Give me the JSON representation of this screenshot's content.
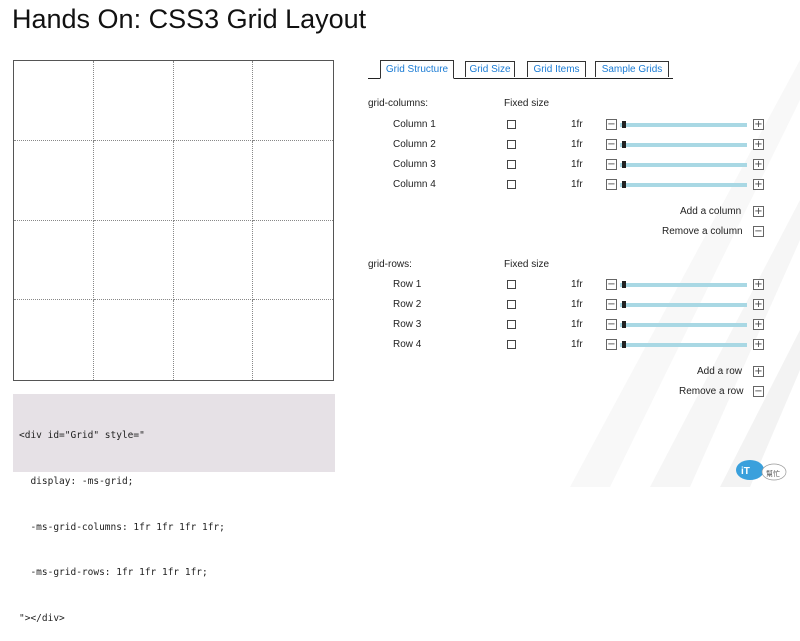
{
  "page": {
    "title": "Hands On: CSS3 Grid Layout"
  },
  "code": {
    "lines": [
      "<div id=\"Grid\" style=\"",
      "  display: -ms-grid;",
      "  -ms-grid-columns: 1fr 1fr 1fr 1fr;",
      "  -ms-grid-rows: 1fr 1fr 1fr 1fr;",
      "\"></div>"
    ]
  },
  "tabs": [
    {
      "label": "Grid Structure",
      "active": true
    },
    {
      "label": "Grid Size",
      "active": false
    },
    {
      "label": "Grid Items",
      "active": false
    },
    {
      "label": "Sample Grids",
      "active": false
    }
  ],
  "columns_section": {
    "label": "grid-columns:",
    "fixed_label": "Fixed size",
    "items": [
      {
        "name": "Column 1",
        "checked": false,
        "value": "1fr"
      },
      {
        "name": "Column 2",
        "checked": false,
        "value": "1fr"
      },
      {
        "name": "Column 3",
        "checked": false,
        "value": "1fr"
      },
      {
        "name": "Column 4",
        "checked": false,
        "value": "1fr"
      }
    ],
    "add_label": "Add a column",
    "remove_label": "Remove a column"
  },
  "rows_section": {
    "label": "grid-rows:",
    "fixed_label": "Fixed size",
    "items": [
      {
        "name": "Row 1",
        "checked": false,
        "value": "1fr"
      },
      {
        "name": "Row 2",
        "checked": false,
        "value": "1fr"
      },
      {
        "name": "Row 3",
        "checked": false,
        "value": "1fr"
      },
      {
        "name": "Row 4",
        "checked": false,
        "value": "1fr"
      }
    ],
    "add_label": "Add a row",
    "remove_label": "Remove a row"
  },
  "icons": {
    "plus": "+",
    "minus": "−"
  },
  "logo": {
    "text": "iT邦幫忙"
  },
  "colors": {
    "accent": "#1a7bd4",
    "slider": "#a9d8e4"
  }
}
